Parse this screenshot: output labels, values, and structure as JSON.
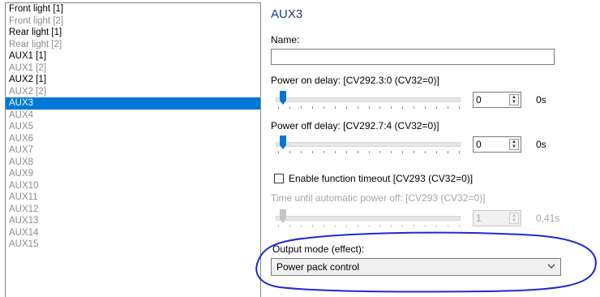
{
  "list": {
    "items": [
      {
        "label": "Front light [1]",
        "state": "active"
      },
      {
        "label": "Front light [2]",
        "state": "inactive"
      },
      {
        "label": "Rear light [1]",
        "state": "active"
      },
      {
        "label": "Rear light [2]",
        "state": "inactive"
      },
      {
        "label": "AUX1 [1]",
        "state": "active"
      },
      {
        "label": "AUX1 [2]",
        "state": "inactive"
      },
      {
        "label": "AUX2 [1]",
        "state": "active"
      },
      {
        "label": "AUX2 [2]",
        "state": "inactive"
      },
      {
        "label": "AUX3",
        "state": "selected"
      },
      {
        "label": "AUX4",
        "state": "inactive"
      },
      {
        "label": "AUX5",
        "state": "inactive"
      },
      {
        "label": "AUX6",
        "state": "inactive"
      },
      {
        "label": "AUX7",
        "state": "inactive"
      },
      {
        "label": "AUX8",
        "state": "inactive"
      },
      {
        "label": "AUX9",
        "state": "inactive"
      },
      {
        "label": "AUX10",
        "state": "inactive"
      },
      {
        "label": "AUX11",
        "state": "inactive"
      },
      {
        "label": "AUX12",
        "state": "inactive"
      },
      {
        "label": "AUX13",
        "state": "inactive"
      },
      {
        "label": "AUX14",
        "state": "inactive"
      },
      {
        "label": "AUX15",
        "state": "inactive"
      }
    ]
  },
  "panel": {
    "title": "AUX3",
    "name_label": "Name:",
    "name_value": "",
    "power_on": {
      "label": "Power on delay: [CV292.3:0 (CV32=0)]",
      "value": "0",
      "unit": "0s",
      "level": 0
    },
    "power_off": {
      "label": "Power off delay: [CV292.7:4 (CV32=0)]",
      "value": "0",
      "unit": "0s",
      "level": 0
    },
    "timeout_checkbox": {
      "label": "Enable function timeout [CV293 (CV32=0)]",
      "checked": false
    },
    "auto_off": {
      "label": "Time until automatic power off: [CV293 (CV32=0)]",
      "value": "1",
      "unit": "0,41s",
      "level": 0
    },
    "output_mode": {
      "label": "Output mode (effect):",
      "value": "Power pack control"
    }
  },
  "colors": {
    "selection": "#0078d7",
    "title": "#1a3c8c",
    "annotation": "#1b2ad6"
  }
}
